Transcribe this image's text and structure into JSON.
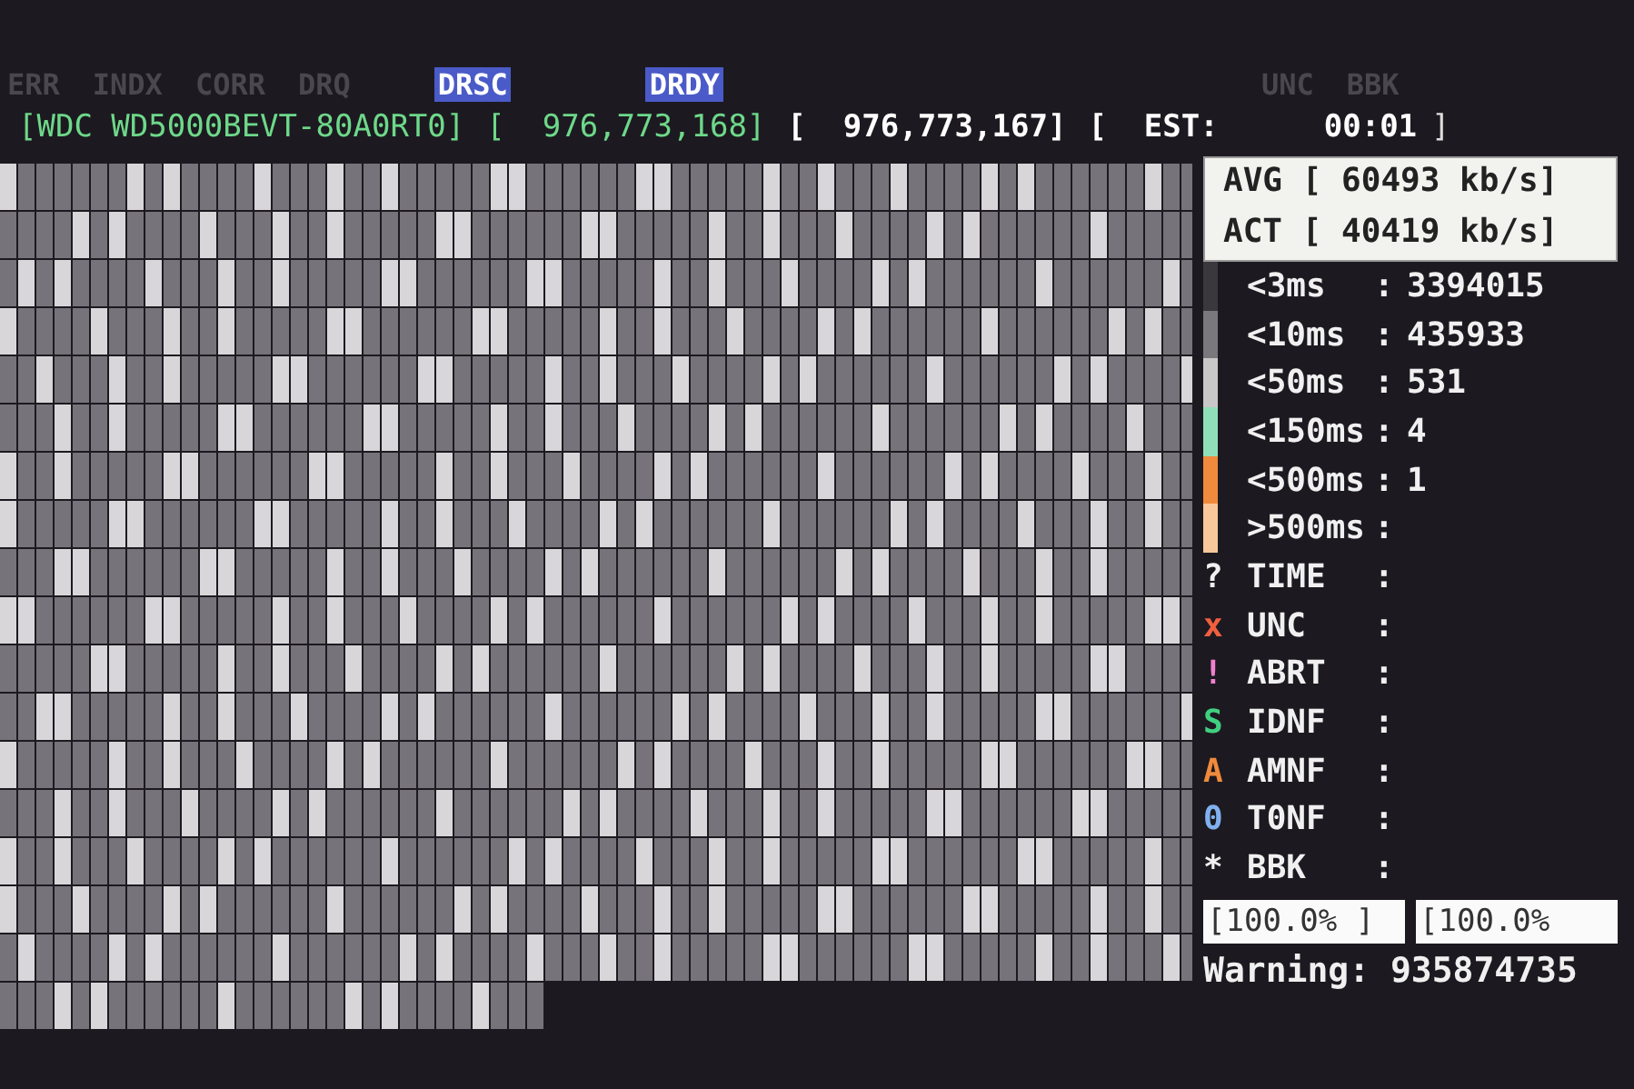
{
  "flags": [
    {
      "label": "ERR",
      "active": false
    },
    {
      "label": "INDX",
      "active": false
    },
    {
      "label": "CORR",
      "active": false
    },
    {
      "label": "DRQ",
      "active": false
    },
    {
      "label": "DRSC",
      "active": true
    },
    {
      "label": "DRDY",
      "active": true
    },
    {
      "label": "UNC",
      "active": false
    },
    {
      "label": "BBK",
      "active": false
    }
  ],
  "drive": [
    {
      "text": "[WDC WD5000BEVT-80A0RT0]",
      "kind": "model"
    },
    {
      "text": "[  976,773,168]",
      "kind": "green"
    },
    {
      "text": "[  976,773,167]",
      "kind": "white"
    },
    {
      "text": "[  EST:",
      "kind": "white"
    },
    {
      "text": "00:01",
      "kind": "time"
    },
    {
      "text": "]",
      "kind": "bracket"
    }
  ],
  "speed": [
    {
      "text": "AVG [ 60493 kb/s]"
    },
    {
      "text": "ACT [ 40419 kb/s]"
    }
  ],
  "latency": [
    {
      "label": "<3ms",
      "sep": ":",
      "count": "3394015",
      "color": "#3a383c"
    },
    {
      "label": "<10ms",
      "sep": ":",
      "count": "435933",
      "color": "#7a787c"
    },
    {
      "label": "<50ms",
      "sep": ":",
      "count": "531",
      "color": "#c8c8c8"
    },
    {
      "label": "<150ms",
      "sep": ":",
      "count": "4",
      "color": "#8fe0b8"
    },
    {
      "label": "<500ms",
      "sep": ":",
      "count": "1",
      "color": "#f08a3c"
    },
    {
      "label": ">500ms",
      "sep": ":",
      "color": "#f8c89a"
    }
  ],
  "errors": [
    {
      "symbol": "?",
      "label": "TIME",
      "sep": ":",
      "color": "#f0f0f0"
    },
    {
      "symbol": "x",
      "label": "UNC",
      "sep": ":",
      "color": "#f06040"
    },
    {
      "symbol": "!",
      "label": "ABRT",
      "sep": ":",
      "color": "#f080d0"
    },
    {
      "symbol": "S",
      "label": "IDNF",
      "sep": ":",
      "color": "#40d080"
    },
    {
      "symbol": "A",
      "label": "AMNF",
      "sep": ":",
      "color": "#f08a3c"
    },
    {
      "symbol": "0",
      "label": "T0NF",
      "sep": ":",
      "color": "#80b0f0"
    },
    {
      "symbol": "*",
      "label": "BBK",
      "sep": ":",
      "color": "#f0f0f0"
    }
  ],
  "progress": [
    {
      "text": "[100.0% ]",
      "level": 1
    },
    {
      "text": "[100.0%",
      "level": 1
    }
  ],
  "warning": "Warning: 935874735"
}
